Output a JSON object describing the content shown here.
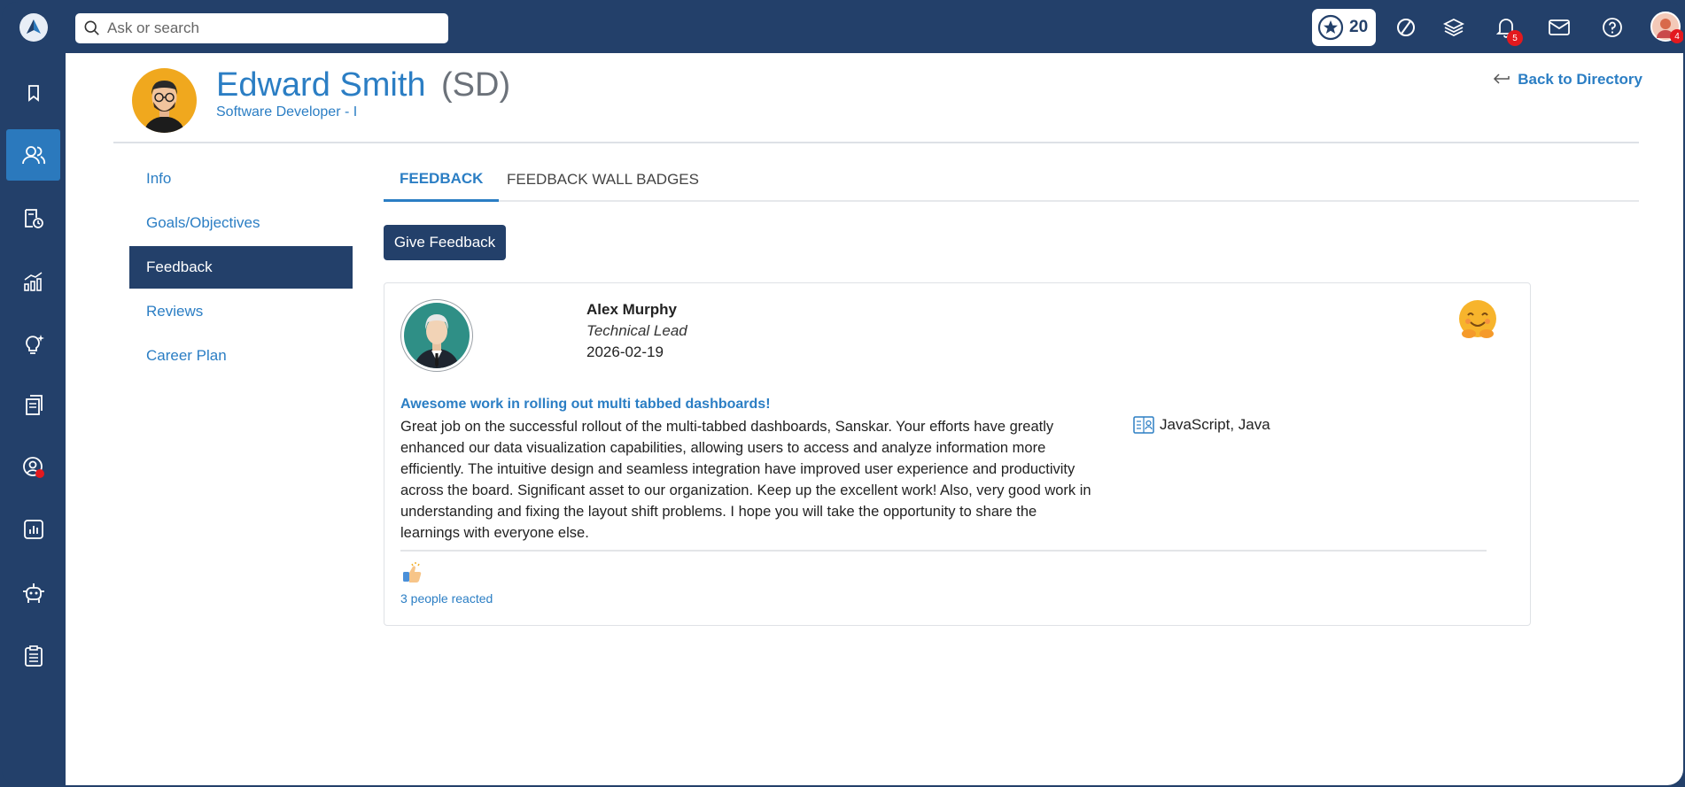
{
  "search": {
    "placeholder": "Ask or search"
  },
  "topbar": {
    "points": "20",
    "notification_count": "5",
    "profile_badge": "4",
    "icons": [
      "star-icon",
      "compass-icon",
      "layers-icon",
      "bell-icon",
      "mail-icon",
      "help-icon",
      "user-avatar"
    ]
  },
  "sidebar": {
    "items": [
      {
        "icon": "bookmark-icon",
        "active": false
      },
      {
        "icon": "people-icon",
        "active": true
      },
      {
        "icon": "payroll-icon",
        "active": false
      },
      {
        "icon": "growth-chart-icon",
        "active": false
      },
      {
        "icon": "idea-icon",
        "active": false
      },
      {
        "icon": "documents-icon",
        "active": false
      },
      {
        "icon": "profile-circle-icon",
        "active": false,
        "dot": true
      },
      {
        "icon": "analytics-icon",
        "active": false
      },
      {
        "icon": "bot-icon",
        "active": false
      },
      {
        "icon": "clipboard-icon",
        "active": false
      }
    ]
  },
  "profile": {
    "name": "Edward Smith",
    "initials": "(SD)",
    "role": "Software Developer - I",
    "back_label": "Back to Directory"
  },
  "subnav": {
    "items": [
      {
        "label": "Info",
        "active": false
      },
      {
        "label": "Goals/Objectives",
        "active": false
      },
      {
        "label": "Feedback",
        "active": true
      },
      {
        "label": "Reviews",
        "active": false
      },
      {
        "label": "Career Plan",
        "active": false
      }
    ]
  },
  "tabs": {
    "feedback": "FEEDBACK",
    "wall_badges": "FEEDBACK WALL BADGES"
  },
  "actions": {
    "give_feedback": "Give Feedback"
  },
  "feedback_card": {
    "giver_name": "Alex Murphy",
    "giver_title": "Technical Lead",
    "date": "2026-02-19",
    "title": "Awesome work in rolling out multi tabbed dashboards!",
    "body": "Great job on the successful rollout of the multi-tabbed dashboards, Sanskar. Your efforts have greatly enhanced our data visualization capabilities, allowing users to access and analyze information more efficiently. The intuitive design and seamless integration have improved user experience and productivity across the board. Significant asset to our organization. Keep up the excellent work! Also, very good work in understanding and fixing the layout shift problems. I hope you will take the opportunity to share the learnings with everyone else.",
    "skills": "JavaScript, Java",
    "reactions": "3 people reacted"
  },
  "colors": {
    "navy": "#23406a",
    "accent_blue": "#2b7ec4",
    "badge_red": "#e3191e"
  }
}
